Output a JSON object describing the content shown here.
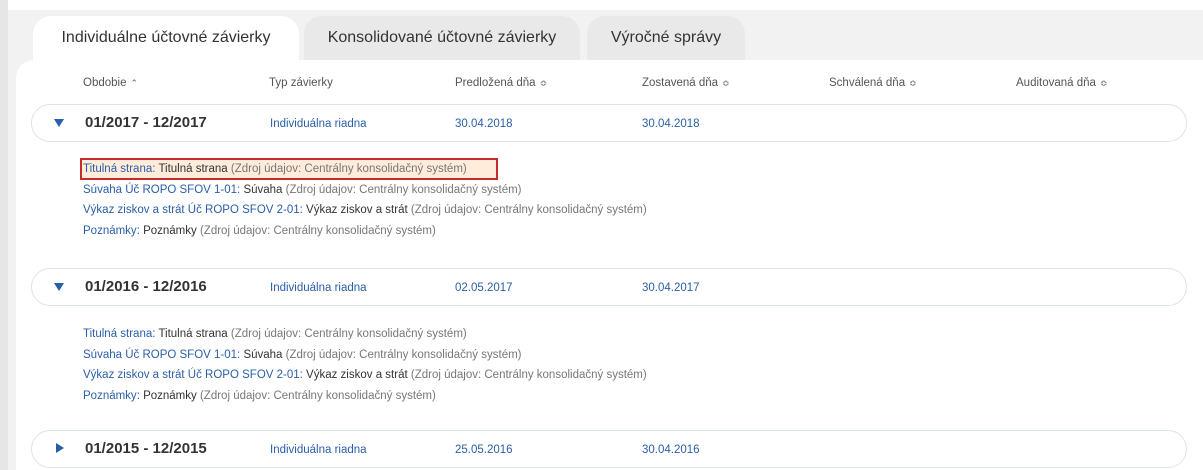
{
  "tabs": [
    {
      "label": "Individuálne účtovné závierky",
      "active": true
    },
    {
      "label": "Konsolidované účtovné závierky",
      "active": false
    },
    {
      "label": "Výročné správy",
      "active": false
    }
  ],
  "columns": {
    "obdobie": "Obdobie",
    "typ": "Typ závierky",
    "predlozena": "Predložená dňa",
    "zostavena": "Zostavená dňa",
    "schvalena": "Schválená dňa",
    "auditovana": "Auditovaná dňa",
    "sort_asc_glyph": "⌃",
    "sort_both_glyph": "≎"
  },
  "rows": [
    {
      "period": "01/2017 - 12/2017",
      "type": "Individuálna riadna",
      "predlozena": "30.04.2018",
      "zostavena": "30.04.2018",
      "expanded": true,
      "docs": [
        {
          "link": "Titulná strana",
          "name": "Titulná strana",
          "source": "(Zdroj údajov: Centrálny konsolidačný systém)"
        },
        {
          "link": "Súvaha Úč ROPO SFOV 1-01",
          "name": "Súvaha",
          "source": "(Zdroj údajov: Centrálny konsolidačný systém)"
        },
        {
          "link": "Výkaz ziskov a strát Úč ROPO SFOV 2-01",
          "name": "Výkaz ziskov a strát",
          "source": "(Zdroj údajov: Centrálny konsolidačný systém)"
        },
        {
          "link": "Poznámky",
          "name": "Poznámky",
          "source": "(Zdroj údajov: Centrálny konsolidačný systém)"
        }
      ]
    },
    {
      "period": "01/2016 - 12/2016",
      "type": "Individuálna riadna",
      "predlozena": "02.05.2017",
      "zostavena": "30.04.2017",
      "expanded": true,
      "docs": [
        {
          "link": "Titulná strana",
          "name": "Titulná strana",
          "source": "(Zdroj údajov: Centrálny konsolidačný systém)"
        },
        {
          "link": "Súvaha Úč ROPO SFOV 1-01",
          "name": "Súvaha",
          "source": "(Zdroj údajov: Centrálny konsolidačný systém)"
        },
        {
          "link": "Výkaz ziskov a strát Úč ROPO SFOV 2-01",
          "name": "Výkaz ziskov a strát",
          "source": "(Zdroj údajov: Centrálny konsolidačný systém)"
        },
        {
          "link": "Poznámky",
          "name": "Poznámky",
          "source": "(Zdroj údajov: Centrálny konsolidačný systém)"
        }
      ]
    },
    {
      "period": "01/2015 - 12/2015",
      "type": "Individuálna riadna",
      "predlozena": "25.05.2016",
      "zostavena": "30.04.2016",
      "expanded": false,
      "docs": []
    }
  ],
  "colors": {
    "link": "#2a5ea8",
    "highlight_border": "#c82b2b"
  }
}
